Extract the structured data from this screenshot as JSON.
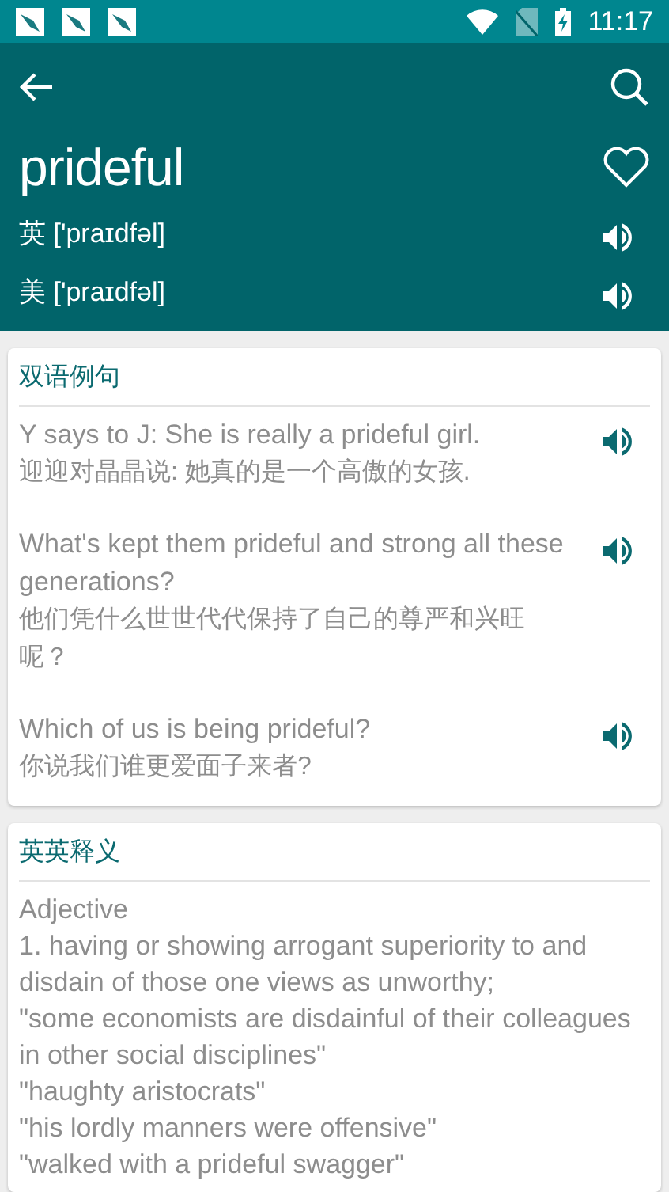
{
  "status_bar": {
    "time": "11:17"
  },
  "header": {
    "word": "prideful",
    "favorite": false,
    "pronunciations": [
      {
        "region": "英",
        "phonetic": "['praɪdfəl]"
      },
      {
        "region": "美",
        "phonetic": "['praɪdfəl]"
      }
    ]
  },
  "examples": {
    "title": "双语例句",
    "items": [
      {
        "english": "Y says to J: She is really a prideful girl.",
        "chinese": "迎迎对晶晶说: 她真的是一个高傲的女孩."
      },
      {
        "english": "What's kept them prideful and strong all these generations?",
        "chinese": "他们凭什么世世代代保持了自己的尊严和兴旺呢？"
      },
      {
        "english": "Which of us is being prideful?",
        "chinese": "你说我们谁更爱面子来者?"
      }
    ]
  },
  "definitions": {
    "title": "英英释义",
    "lines": [
      "Adjective",
      "1. having or showing arrogant superiority to and disdain of those one views as unworthy;",
      "\"some economists are disdainful of their colleagues in other social disciplines\"",
      "\"haughty aristocrats\"",
      "\"his lordly manners were offensive\"",
      "\"walked with a prideful swagger\""
    ]
  }
}
